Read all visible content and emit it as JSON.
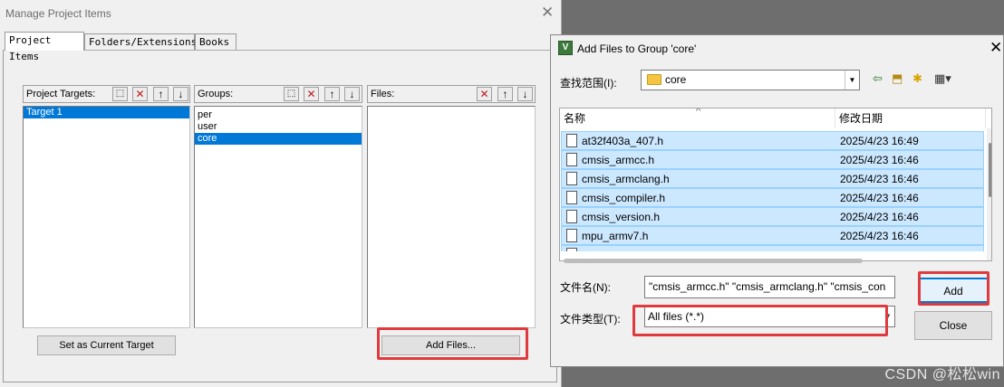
{
  "manage_dialog": {
    "title": "Manage Project Items",
    "close_glyph": "✕",
    "tabs": [
      "Project Items",
      "Folders/Extensions",
      "Books"
    ],
    "targets": {
      "header": "Project Targets:",
      "items": [
        {
          "label": "Target 1",
          "selected": true
        }
      ]
    },
    "groups": {
      "header": "Groups:",
      "items": [
        {
          "label": "per",
          "selected": false
        },
        {
          "label": "user",
          "selected": false
        },
        {
          "label": "core",
          "selected": true
        }
      ]
    },
    "files": {
      "header": "Files:",
      "items": []
    },
    "set_current_target_label": "Set as Current Target",
    "add_files_label": "Add Files..."
  },
  "add_files_dialog": {
    "title": "Add Files to Group 'core'",
    "close_glyph": "✕",
    "look_in_label": "查找范围(I):",
    "look_in_value": "core",
    "columns": {
      "name": "名称",
      "date": "修改日期"
    },
    "files": [
      {
        "name": "at32f403a_407.h",
        "modified": "2025/4/23 16:49",
        "selected": true
      },
      {
        "name": "cmsis_armcc.h",
        "modified": "2025/4/23 16:46",
        "selected": true
      },
      {
        "name": "cmsis_armclang.h",
        "modified": "2025/4/23 16:46",
        "selected": true
      },
      {
        "name": "cmsis_compiler.h",
        "modified": "2025/4/23 16:46",
        "selected": true
      },
      {
        "name": "cmsis_version.h",
        "modified": "2025/4/23 16:46",
        "selected": true
      },
      {
        "name": "mpu_armv7.h",
        "modified": "2025/4/23 16:46",
        "selected": true
      }
    ],
    "filename_label": "文件名(N):",
    "filename_value": "\"cmsis_armcc.h\" \"cmsis_armclang.h\" \"cmsis_con",
    "filetype_label": "文件类型(T):",
    "filetype_value": "All files (*.*)",
    "add_label": "Add",
    "close_label": "Close"
  },
  "watermark": "CSDN @松松win",
  "colors": {
    "selection": "#0078d7",
    "highlight_box": "#e0393e",
    "file_selection": "#cce8ff"
  }
}
